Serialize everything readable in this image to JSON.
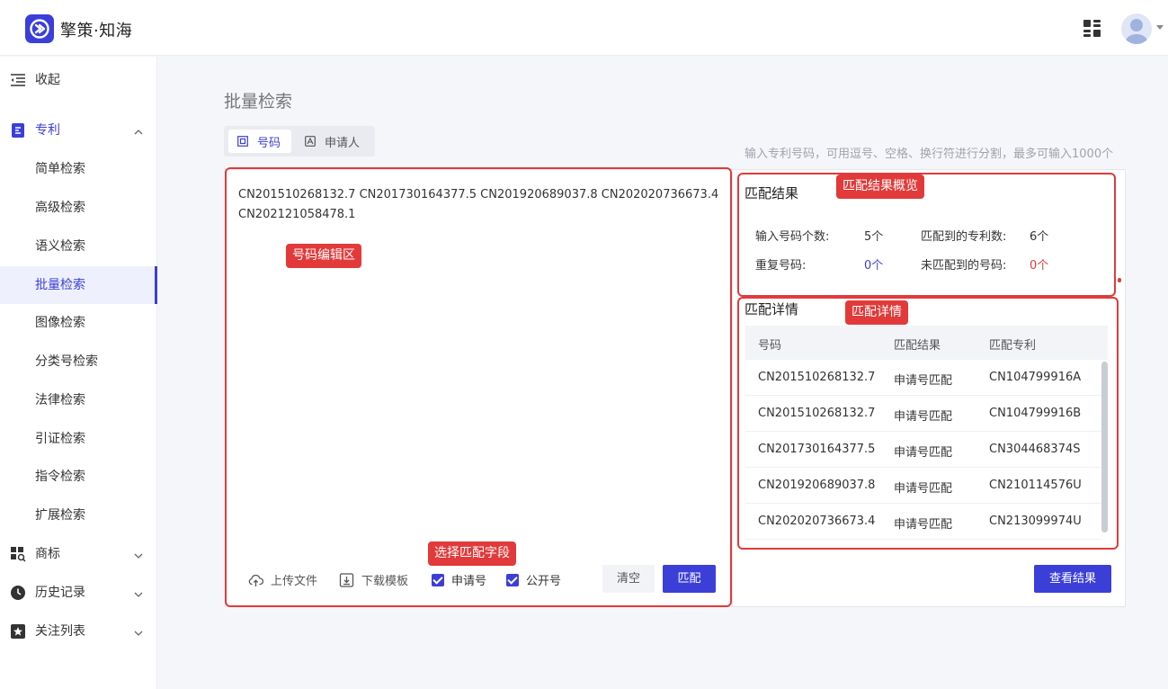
{
  "app": {
    "name": "擎策·知海"
  },
  "sidebar": {
    "collapse_label": "收起",
    "patent": {
      "label": "专利",
      "items": [
        {
          "label": "简单检索"
        },
        {
          "label": "高级检索"
        },
        {
          "label": "语义检索"
        },
        {
          "label": "批量检索",
          "active": true
        },
        {
          "label": "图像检索"
        },
        {
          "label": "分类号检索"
        },
        {
          "label": "法律检索"
        },
        {
          "label": "引证检索"
        },
        {
          "label": "指令检索"
        },
        {
          "label": "扩展检索"
        }
      ]
    },
    "trademark_label": "商标",
    "history_label": "历史记录",
    "follow_label": "关注列表"
  },
  "page": {
    "title": "批量检索",
    "tabs": [
      {
        "label": "号码",
        "active": true
      },
      {
        "label": "申请人"
      }
    ],
    "hint": "输入专利号码，可用逗号、空格、换行符进行分割，最多可输入1000个"
  },
  "editor": {
    "content": "CN201510268132.7 CN201730164377.5 CN201920689037.8 CN202020736673.4 CN202121058478.1",
    "annotation": "号码编辑区",
    "upload_label": "上传文件",
    "download_label": "下载模板",
    "field_annotation": "选择匹配字段",
    "checkbox_app_no": "申请号",
    "checkbox_pub_no": "公开号",
    "clear_label": "清空",
    "match_label": "匹配"
  },
  "summary": {
    "title": "匹配结果",
    "annotation": "匹配结果概览",
    "input_count_label": "输入号码个数:",
    "input_count_value": "5个",
    "matched_label": "匹配到的专利数:",
    "matched_value": "6个",
    "duplicate_label": "重复号码:",
    "duplicate_value": "0个",
    "unmatched_label": "未匹配到的号码:",
    "unmatched_value": "0个"
  },
  "details": {
    "title": "匹配详情",
    "annotation": "匹配详情",
    "columns": [
      "号码",
      "匹配结果",
      "匹配专利"
    ],
    "rows": [
      [
        "CN201510268132.7",
        "申请号匹配",
        "CN104799916A"
      ],
      [
        "CN201510268132.7",
        "申请号匹配",
        "CN104799916B"
      ],
      [
        "CN201730164377.5",
        "申请号匹配",
        "CN304468374S"
      ],
      [
        "CN201920689037.8",
        "申请号匹配",
        "CN210114576U"
      ],
      [
        "CN202020736673.4",
        "申请号匹配",
        "CN213099974U"
      ]
    ],
    "view_label": "查看结果"
  },
  "colors": {
    "accent": "#3b3fd8",
    "annotation_red": "#e23a3a"
  }
}
